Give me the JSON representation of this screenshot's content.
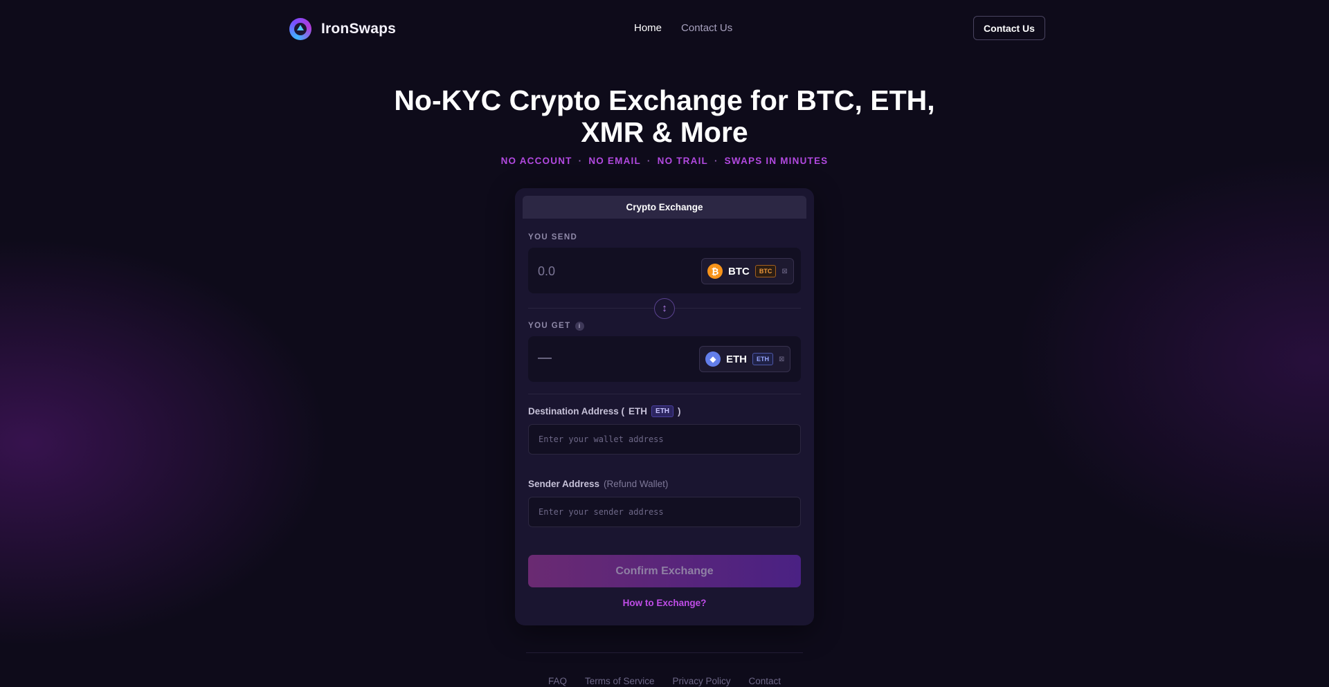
{
  "brand": {
    "name": "IronSwaps"
  },
  "nav": {
    "items": [
      {
        "label": "Home"
      },
      {
        "label": "Contact Us"
      }
    ],
    "cta": "Contact Us"
  },
  "hero": {
    "title": "No-KYC Crypto Exchange for BTC, ETH, XMR & More",
    "tags": [
      "NO ACCOUNT",
      "NO EMAIL",
      "NO TRAIL",
      "SWAPS IN MINUTES"
    ],
    "separator": "·"
  },
  "exchange": {
    "tab": "Crypto Exchange",
    "send": {
      "label": "YOU SEND",
      "placeholder": "0.0",
      "coin": {
        "code": "BTC",
        "badge": "BTC",
        "glyph": "₿",
        "color": "#f7931a"
      }
    },
    "swap_glyph": "↕",
    "get": {
      "label": "YOU GET",
      "info": "i",
      "value": "—",
      "coin": {
        "code": "ETH",
        "badge": "ETH",
        "glyph": "◆",
        "color": "#627eea"
      }
    },
    "destination": {
      "label": "Destination Address (",
      "coin": "ETH",
      "badge": "ETH",
      "close": ")",
      "placeholder": "Enter your wallet address"
    },
    "sender": {
      "label": "Sender Address",
      "hint": "(Refund Wallet)",
      "placeholder": "Enter your sender address"
    },
    "confirm": "Confirm Exchange",
    "how": "How to Exchange?"
  },
  "footer": {
    "links": [
      {
        "label": "FAQ"
      },
      {
        "label": "Terms of Service"
      },
      {
        "label": "Privacy Policy"
      },
      {
        "label": "Contact"
      }
    ]
  }
}
